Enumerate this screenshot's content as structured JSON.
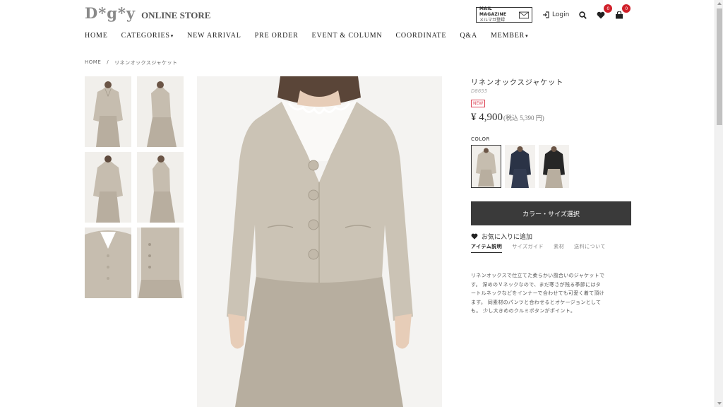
{
  "header": {
    "logo_mark": "D*g*y",
    "logo_text": "ONLINE STORE",
    "mail_magazine_en": "MAIL MAGAZINE",
    "mail_magazine_jp": "メルマガ登録",
    "login_label": "Login",
    "favorites_count": "0",
    "cart_count": "0",
    "icons": [
      "mail-icon",
      "login-icon",
      "search-icon",
      "heart-icon",
      "cart-icon"
    ]
  },
  "nav": {
    "items": [
      {
        "label": "HOME"
      },
      {
        "label": "CATEGORIES",
        "caret": "▾"
      },
      {
        "label": "NEW ARRIVAL"
      },
      {
        "label": "PRE ORDER"
      },
      {
        "label": "EVENT & COLUMN"
      },
      {
        "label": "COORDINATE"
      },
      {
        "label": "Q&A"
      },
      {
        "label": "MEMBER",
        "caret": "▾"
      }
    ]
  },
  "breadcrumb": {
    "home": "HOME",
    "separator": "/",
    "current": "リネンオックスジャケット"
  },
  "product": {
    "title": "リネンオックスジャケット",
    "code": "D8655",
    "new_badge": "NEW",
    "price": "¥ 4,900",
    "price_tax": "(税込 5,390 円)",
    "color_label": "COLOR",
    "swatches": [
      {
        "color": "beige",
        "selected": true
      },
      {
        "color": "navy",
        "selected": false
      },
      {
        "color": "black",
        "selected": false
      }
    ],
    "select_button": "カラー・サイズ選択",
    "favorite_label": "お気に入りに追加",
    "tabs": [
      {
        "label": "アイテム説明",
        "active": true
      },
      {
        "label": "サイズガイド",
        "active": false
      },
      {
        "label": "素材",
        "active": false
      },
      {
        "label": "送料について",
        "active": false
      }
    ],
    "description_lines": [
      "リネンオックスで仕立てた柔らかい風合いのジャケットで",
      "す。 深めのＶネックなので、まだ寒さが残る季節にはタ",
      "ートルネックなどをインナーで合わせても可愛く着て頂け",
      "ます。 同素材のパンツと合わせるとオケージョンとして",
      "も。 少し大きめのクルミボタンがポイント。"
    ]
  },
  "colors": {
    "linen": "#c9c1b4",
    "linen_dark": "#b3aa9b",
    "navy": "#2a3346",
    "black": "#262626",
    "button_bg": "#3a3a3a",
    "badge_red": "#d0202a"
  }
}
